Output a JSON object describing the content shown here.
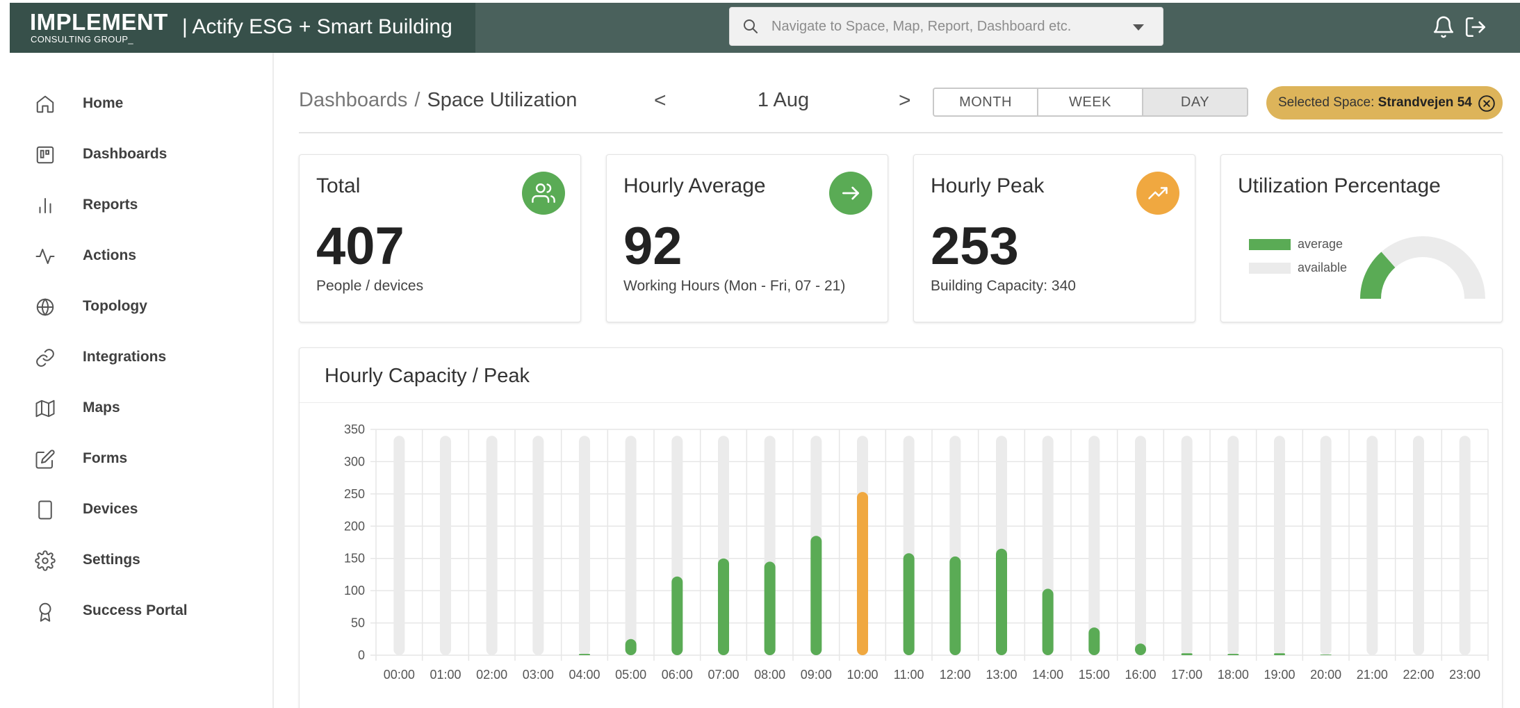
{
  "brand": {
    "name": "IMPLEMENT",
    "sub": "CONSULTING GROUP_",
    "app_title": "| Actify ESG + Smart Building"
  },
  "search": {
    "placeholder": "Navigate to Space, Map, Report, Dashboard etc."
  },
  "header_icons": [
    "bell-icon",
    "logout-icon"
  ],
  "sidebar": {
    "items": [
      {
        "label": "Home",
        "icon": "home-icon"
      },
      {
        "label": "Dashboards",
        "icon": "dashboard-icon"
      },
      {
        "label": "Reports",
        "icon": "bar-chart-icon"
      },
      {
        "label": "Actions",
        "icon": "activity-icon"
      },
      {
        "label": "Topology",
        "icon": "globe-icon"
      },
      {
        "label": "Integrations",
        "icon": "link-icon"
      },
      {
        "label": "Maps",
        "icon": "map-icon"
      },
      {
        "label": "Forms",
        "icon": "edit-icon"
      },
      {
        "label": "Devices",
        "icon": "tablet-icon"
      },
      {
        "label": "Settings",
        "icon": "gear-icon"
      },
      {
        "label": "Success Portal",
        "icon": "award-icon"
      }
    ]
  },
  "breadcrumb": {
    "parent": "Dashboards",
    "separator": "/",
    "current": "Space Utilization"
  },
  "date_nav": {
    "prev": "<",
    "label": "1 Aug",
    "next": ">"
  },
  "period": {
    "options": [
      "MONTH",
      "WEEK",
      "DAY"
    ],
    "selected": "DAY"
  },
  "selected_space": {
    "prefix": "Selected Space:",
    "name": "Strandvejen 54"
  },
  "kpis": {
    "total": {
      "title": "Total",
      "value": "407",
      "sub": "People / devices",
      "icon": "users-icon",
      "color": "#5aab55"
    },
    "hourly_average": {
      "title": "Hourly Average",
      "value": "92",
      "sub": "Working Hours (Mon - Fri, 07 - 21)",
      "icon": "arrow-right-icon",
      "color": "#5aab55"
    },
    "hourly_peak": {
      "title": "Hourly Peak",
      "value": "253",
      "sub": "Building Capacity: 340",
      "icon": "trending-up-icon",
      "color": "#f0a840"
    },
    "utilization": {
      "title": "Utilization Percentage",
      "legend": [
        {
          "label": "average",
          "color": "#5aab55"
        },
        {
          "label": "available",
          "color": "#ebebeb"
        }
      ],
      "percent": 27
    }
  },
  "chart_title": "Hourly Capacity / Peak",
  "chart_data": {
    "type": "bar",
    "categories": [
      "00:00",
      "01:00",
      "02:00",
      "03:00",
      "04:00",
      "05:00",
      "06:00",
      "07:00",
      "08:00",
      "09:00",
      "10:00",
      "11:00",
      "12:00",
      "13:00",
      "14:00",
      "15:00",
      "16:00",
      "17:00",
      "18:00",
      "19:00",
      "20:00",
      "21:00",
      "22:00",
      "23:00"
    ],
    "series": [
      {
        "values": [
          340,
          340,
          340,
          340,
          340,
          340,
          340,
          340,
          340,
          340,
          340,
          340,
          340,
          340,
          340,
          340,
          340,
          340,
          340,
          340,
          340,
          340,
          340,
          340
        ],
        "color": "#ebebeb"
      },
      {
        "values": [
          0,
          0,
          0,
          0,
          2,
          25,
          122,
          150,
          145,
          185,
          253,
          158,
          153,
          165,
          103,
          43,
          18,
          3,
          2,
          3,
          1,
          0,
          0,
          0
        ],
        "color": "#5aab55",
        "peak_color": "#f0a840"
      }
    ],
    "y_ticks": [
      0,
      50,
      100,
      150,
      200,
      250,
      300,
      350
    ],
    "ylim": [
      0,
      350
    ],
    "grid": true
  }
}
